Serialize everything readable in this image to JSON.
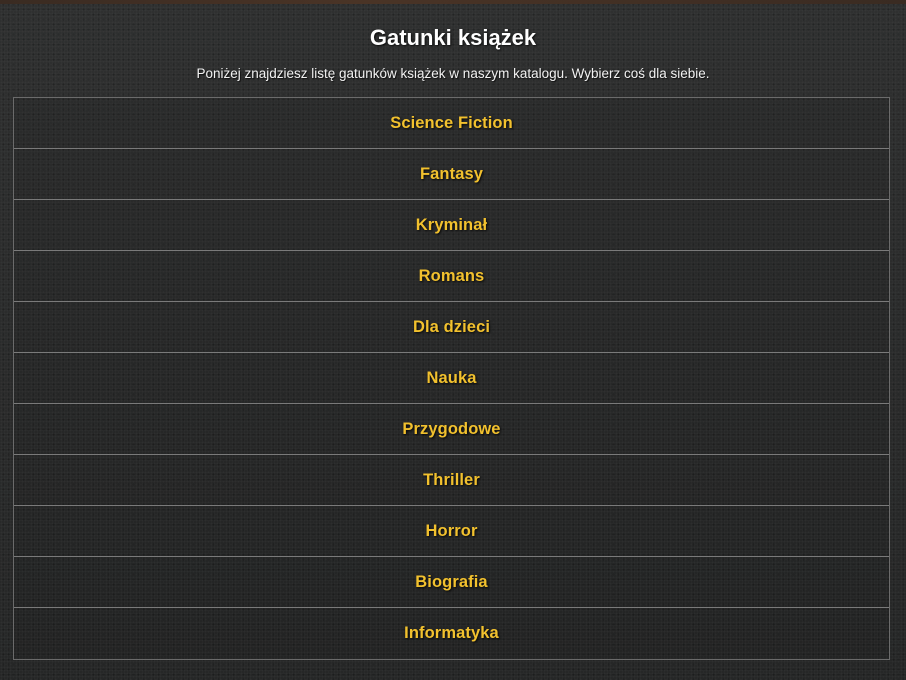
{
  "header": {
    "title": "Gatunki książek",
    "subtitle": "Poniżej znajdziesz listę gatunków książek w naszym katalogu. Wybierz coś dla siebie."
  },
  "genres": [
    {
      "label": "Science Fiction"
    },
    {
      "label": "Fantasy"
    },
    {
      "label": "Kryminał"
    },
    {
      "label": "Romans"
    },
    {
      "label": "Dla dzieci"
    },
    {
      "label": "Nauka"
    },
    {
      "label": "Przygodowe"
    },
    {
      "label": "Thriller"
    },
    {
      "label": "Horror"
    },
    {
      "label": "Biografia"
    },
    {
      "label": "Informatyka"
    }
  ],
  "colors": {
    "background": "#2b2c2c",
    "genre_text": "#f2c12e",
    "title_text": "#ffffff",
    "divider": "#7a7a7a"
  }
}
